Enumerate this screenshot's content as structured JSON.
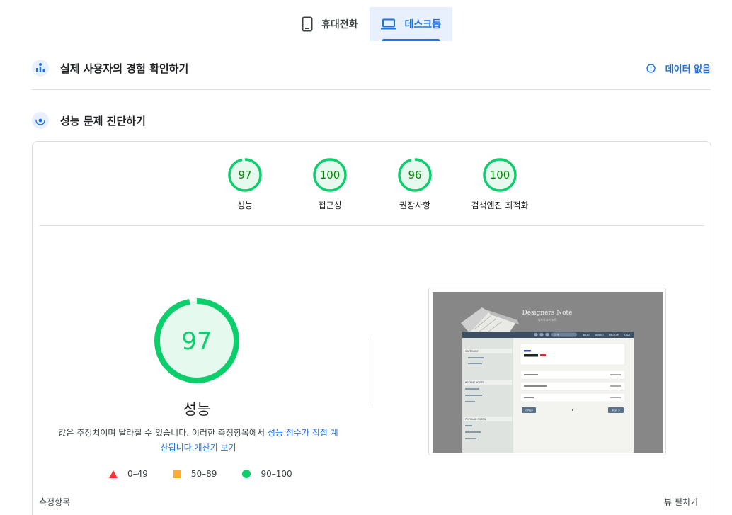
{
  "tabs": [
    {
      "label": "휴대전화",
      "icon": "phone-icon",
      "active": false
    },
    {
      "label": "데스크톱",
      "icon": "laptop-icon",
      "active": true
    }
  ],
  "field_data": {
    "title": "실제 사용자의 경험 확인하기",
    "status": "데이터 없음"
  },
  "diagnostics": {
    "title": "성능 문제 진단하기"
  },
  "scores": [
    {
      "label": "성능",
      "value": "97",
      "fraction": 0.97
    },
    {
      "label": "접근성",
      "value": "100",
      "fraction": 1.0
    },
    {
      "label": "권장사항",
      "value": "96",
      "fraction": 0.96
    },
    {
      "label": "검색엔진 최적화",
      "value": "100",
      "fraction": 1.0
    }
  ],
  "performance": {
    "score": "97",
    "fraction": 0.97,
    "label": "성능",
    "note_prefix": "값은 추정치이며 달라질 수 있습니다. 이러한 측정항목에서 ",
    "note_link1": "성능 점수가 직접 계산됩니다.",
    "note_link2": "계산기 보기"
  },
  "legend": [
    {
      "range": "0–49",
      "shape": "triangle",
      "color": "#ff3333"
    },
    {
      "range": "50–89",
      "shape": "square",
      "color": "#ffaa33"
    },
    {
      "range": "90–100",
      "shape": "circle",
      "color": "#0cce6b"
    }
  ],
  "screenshot": {
    "site_title": "Designers Note",
    "site_subtitle": "디자이너스 노트",
    "search_placeholder": "검색",
    "nav": [
      "BLOG",
      "ABOUT",
      "HISTORY",
      "Q&A"
    ],
    "sidebar_sections": [
      "CATEGORY",
      "RECENT POSTS",
      "POPULAR POSTS"
    ],
    "prev": "< Prev",
    "next": "Next >"
  },
  "metrics_label": "측정항목",
  "expand_label": "뷰 펼치기",
  "colors": {
    "accent": "#1a73e8",
    "pass": "#0cce6b",
    "pass_bg": "#e6f9ee",
    "pass_text": "#008800"
  }
}
